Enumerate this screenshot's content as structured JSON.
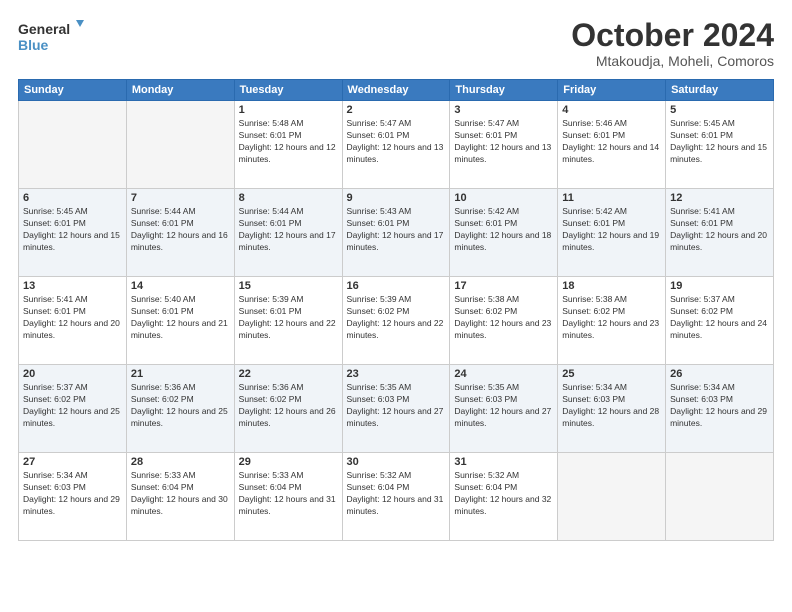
{
  "logo": {
    "line1": "General",
    "line2": "Blue"
  },
  "title": "October 2024",
  "subtitle": "Mtakoudja, Moheli, Comoros",
  "weekdays": [
    "Sunday",
    "Monday",
    "Tuesday",
    "Wednesday",
    "Thursday",
    "Friday",
    "Saturday"
  ],
  "weeks": [
    [
      {
        "day": "",
        "empty": true
      },
      {
        "day": "",
        "empty": true
      },
      {
        "day": "1",
        "sunrise": "5:48 AM",
        "sunset": "6:01 PM",
        "daylight": "12 hours and 12 minutes."
      },
      {
        "day": "2",
        "sunrise": "5:47 AM",
        "sunset": "6:01 PM",
        "daylight": "12 hours and 13 minutes."
      },
      {
        "day": "3",
        "sunrise": "5:47 AM",
        "sunset": "6:01 PM",
        "daylight": "12 hours and 13 minutes."
      },
      {
        "day": "4",
        "sunrise": "5:46 AM",
        "sunset": "6:01 PM",
        "daylight": "12 hours and 14 minutes."
      },
      {
        "day": "5",
        "sunrise": "5:45 AM",
        "sunset": "6:01 PM",
        "daylight": "12 hours and 15 minutes."
      }
    ],
    [
      {
        "day": "6",
        "sunrise": "5:45 AM",
        "sunset": "6:01 PM",
        "daylight": "12 hours and 15 minutes."
      },
      {
        "day": "7",
        "sunrise": "5:44 AM",
        "sunset": "6:01 PM",
        "daylight": "12 hours and 16 minutes."
      },
      {
        "day": "8",
        "sunrise": "5:44 AM",
        "sunset": "6:01 PM",
        "daylight": "12 hours and 17 minutes."
      },
      {
        "day": "9",
        "sunrise": "5:43 AM",
        "sunset": "6:01 PM",
        "daylight": "12 hours and 17 minutes."
      },
      {
        "day": "10",
        "sunrise": "5:42 AM",
        "sunset": "6:01 PM",
        "daylight": "12 hours and 18 minutes."
      },
      {
        "day": "11",
        "sunrise": "5:42 AM",
        "sunset": "6:01 PM",
        "daylight": "12 hours and 19 minutes."
      },
      {
        "day": "12",
        "sunrise": "5:41 AM",
        "sunset": "6:01 PM",
        "daylight": "12 hours and 20 minutes."
      }
    ],
    [
      {
        "day": "13",
        "sunrise": "5:41 AM",
        "sunset": "6:01 PM",
        "daylight": "12 hours and 20 minutes."
      },
      {
        "day": "14",
        "sunrise": "5:40 AM",
        "sunset": "6:01 PM",
        "daylight": "12 hours and 21 minutes."
      },
      {
        "day": "15",
        "sunrise": "5:39 AM",
        "sunset": "6:01 PM",
        "daylight": "12 hours and 22 minutes."
      },
      {
        "day": "16",
        "sunrise": "5:39 AM",
        "sunset": "6:02 PM",
        "daylight": "12 hours and 22 minutes."
      },
      {
        "day": "17",
        "sunrise": "5:38 AM",
        "sunset": "6:02 PM",
        "daylight": "12 hours and 23 minutes."
      },
      {
        "day": "18",
        "sunrise": "5:38 AM",
        "sunset": "6:02 PM",
        "daylight": "12 hours and 23 minutes."
      },
      {
        "day": "19",
        "sunrise": "5:37 AM",
        "sunset": "6:02 PM",
        "daylight": "12 hours and 24 minutes."
      }
    ],
    [
      {
        "day": "20",
        "sunrise": "5:37 AM",
        "sunset": "6:02 PM",
        "daylight": "12 hours and 25 minutes."
      },
      {
        "day": "21",
        "sunrise": "5:36 AM",
        "sunset": "6:02 PM",
        "daylight": "12 hours and 25 minutes."
      },
      {
        "day": "22",
        "sunrise": "5:36 AM",
        "sunset": "6:02 PM",
        "daylight": "12 hours and 26 minutes."
      },
      {
        "day": "23",
        "sunrise": "5:35 AM",
        "sunset": "6:03 PM",
        "daylight": "12 hours and 27 minutes."
      },
      {
        "day": "24",
        "sunrise": "5:35 AM",
        "sunset": "6:03 PM",
        "daylight": "12 hours and 27 minutes."
      },
      {
        "day": "25",
        "sunrise": "5:34 AM",
        "sunset": "6:03 PM",
        "daylight": "12 hours and 28 minutes."
      },
      {
        "day": "26",
        "sunrise": "5:34 AM",
        "sunset": "6:03 PM",
        "daylight": "12 hours and 29 minutes."
      }
    ],
    [
      {
        "day": "27",
        "sunrise": "5:34 AM",
        "sunset": "6:03 PM",
        "daylight": "12 hours and 29 minutes."
      },
      {
        "day": "28",
        "sunrise": "5:33 AM",
        "sunset": "6:04 PM",
        "daylight": "12 hours and 30 minutes."
      },
      {
        "day": "29",
        "sunrise": "5:33 AM",
        "sunset": "6:04 PM",
        "daylight": "12 hours and 31 minutes."
      },
      {
        "day": "30",
        "sunrise": "5:32 AM",
        "sunset": "6:04 PM",
        "daylight": "12 hours and 31 minutes."
      },
      {
        "day": "31",
        "sunrise": "5:32 AM",
        "sunset": "6:04 PM",
        "daylight": "12 hours and 32 minutes."
      },
      {
        "day": "",
        "empty": true
      },
      {
        "day": "",
        "empty": true
      }
    ]
  ]
}
